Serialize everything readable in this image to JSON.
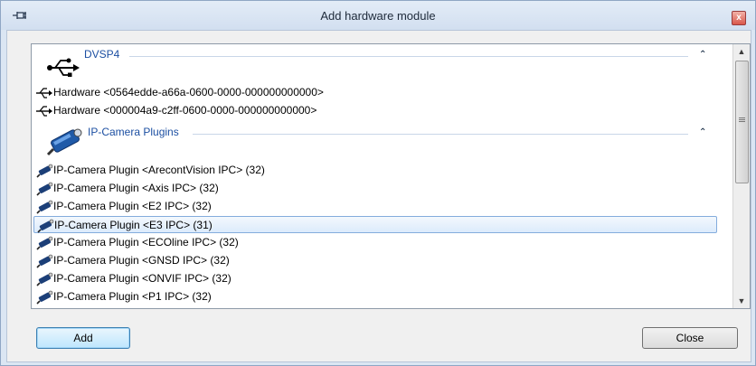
{
  "window": {
    "title": "Add hardware module",
    "close_glyph": "x"
  },
  "groups": [
    {
      "label": "DVSP4",
      "icon": "usb-icon",
      "items": [
        {
          "label": "Hardware <0564edde-a66a-0600-0000-000000000000>",
          "icon": "usb-icon"
        },
        {
          "label": "Hardware <000004a9-c2ff-0600-0000-000000000000>",
          "icon": "usb-icon"
        }
      ]
    },
    {
      "label": "IP-Camera Plugins",
      "icon": "camera-icon",
      "items": [
        {
          "label": "IP-Camera Plugin <ArecontVision IPC> (32)",
          "icon": "camera-icon"
        },
        {
          "label": "IP-Camera Plugin <Axis IPC> (32)",
          "icon": "camera-icon"
        },
        {
          "label": "IP-Camera Plugin <E2 IPC> (32)",
          "icon": "camera-icon"
        },
        {
          "label": "IP-Camera Plugin <E3 IPC> (31)",
          "icon": "camera-icon",
          "selected": true
        },
        {
          "label": "IP-Camera Plugin <ECOline IPC> (32)",
          "icon": "camera-icon"
        },
        {
          "label": "IP-Camera Plugin <GNSD IPC> (32)",
          "icon": "camera-icon"
        },
        {
          "label": "IP-Camera Plugin <ONVIF IPC> (32)",
          "icon": "camera-icon"
        },
        {
          "label": "IP-Camera Plugin <P1 IPC> (32)",
          "icon": "camera-icon"
        }
      ]
    }
  ],
  "buttons": {
    "add_label": "Add",
    "close_label": "Close"
  },
  "colors": {
    "group_label": "#1c4fa2",
    "selection_border": "#84acdd",
    "title_bar": "#dbe6f3"
  }
}
